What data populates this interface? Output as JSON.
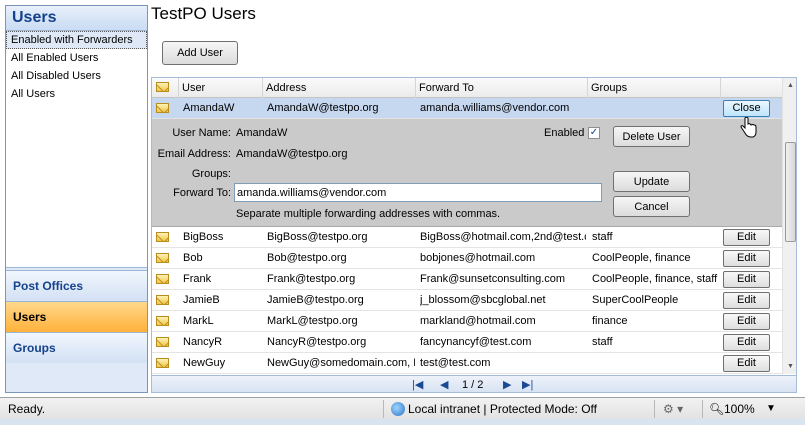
{
  "nav": {
    "title": "Users",
    "items": [
      {
        "label": "Enabled with Forwarders",
        "selected": true
      },
      {
        "label": "All Enabled Users"
      },
      {
        "label": "All Disabled Users"
      },
      {
        "label": "All Users"
      }
    ],
    "sections": [
      {
        "label": "Post Offices"
      },
      {
        "label": "Users",
        "active": true
      },
      {
        "label": "Groups"
      }
    ]
  },
  "page": {
    "title": "TestPO Users",
    "add_button": "Add User"
  },
  "grid": {
    "columns": [
      "User",
      "Address",
      "Forward To",
      "Groups"
    ],
    "selected_row": {
      "user": "AmandaW",
      "address": "AmandaW@testpo.org",
      "forward": "amanda.williams@vendor.com",
      "groups": "",
      "button": "Close"
    },
    "edit_panel": {
      "username_label": "User Name:",
      "username": "AmandaW",
      "email_label": "Email Address:",
      "email": "AmandaW@testpo.org",
      "groups_label": "Groups:",
      "forward_label": "Forward To:",
      "forward_value": "amanda.williams@vendor.com",
      "hint": "Separate multiple forwarding addresses with commas.",
      "enabled_label": "Enabled",
      "enabled_checked": true,
      "delete_button": "Delete User",
      "update_button": "Update",
      "cancel_button": "Cancel"
    },
    "rows": [
      {
        "user": "BigBoss",
        "address": "BigBoss@testpo.org",
        "forward": "BigBoss@hotmail.com,2nd@test.c",
        "groups": "staff",
        "button": "Edit"
      },
      {
        "user": "Bob",
        "address": "Bob@testpo.org",
        "forward": "bobjones@hotmail.com",
        "groups": "CoolPeople, finance",
        "button": "Edit"
      },
      {
        "user": "Frank",
        "address": "Frank@testpo.org",
        "forward": "Frank@sunsetconsulting.com",
        "groups": "CoolPeople, finance, staff",
        "button": "Edit"
      },
      {
        "user": "JamieB",
        "address": "JamieB@testpo.org",
        "forward": "j_blossom@sbcglobal.net",
        "groups": "SuperCoolPeople",
        "button": "Edit"
      },
      {
        "user": "MarkL",
        "address": "MarkL@testpo.org",
        "forward": "markland@hotmail.com",
        "groups": "finance",
        "button": "Edit"
      },
      {
        "user": "NancyR",
        "address": "NancyR@testpo.org",
        "forward": "fancynancyf@test.com",
        "groups": "staff",
        "button": "Edit"
      },
      {
        "user": "NewGuy",
        "address": "NewGuy@somedomain.com, N",
        "forward": "test@test.com",
        "groups": "",
        "button": "Edit"
      }
    ],
    "pager": {
      "text": "1 / 2"
    }
  },
  "status": {
    "ready": "Ready.",
    "zone": "Local intranet | Protected Mode: Off",
    "zoom": "100%"
  }
}
